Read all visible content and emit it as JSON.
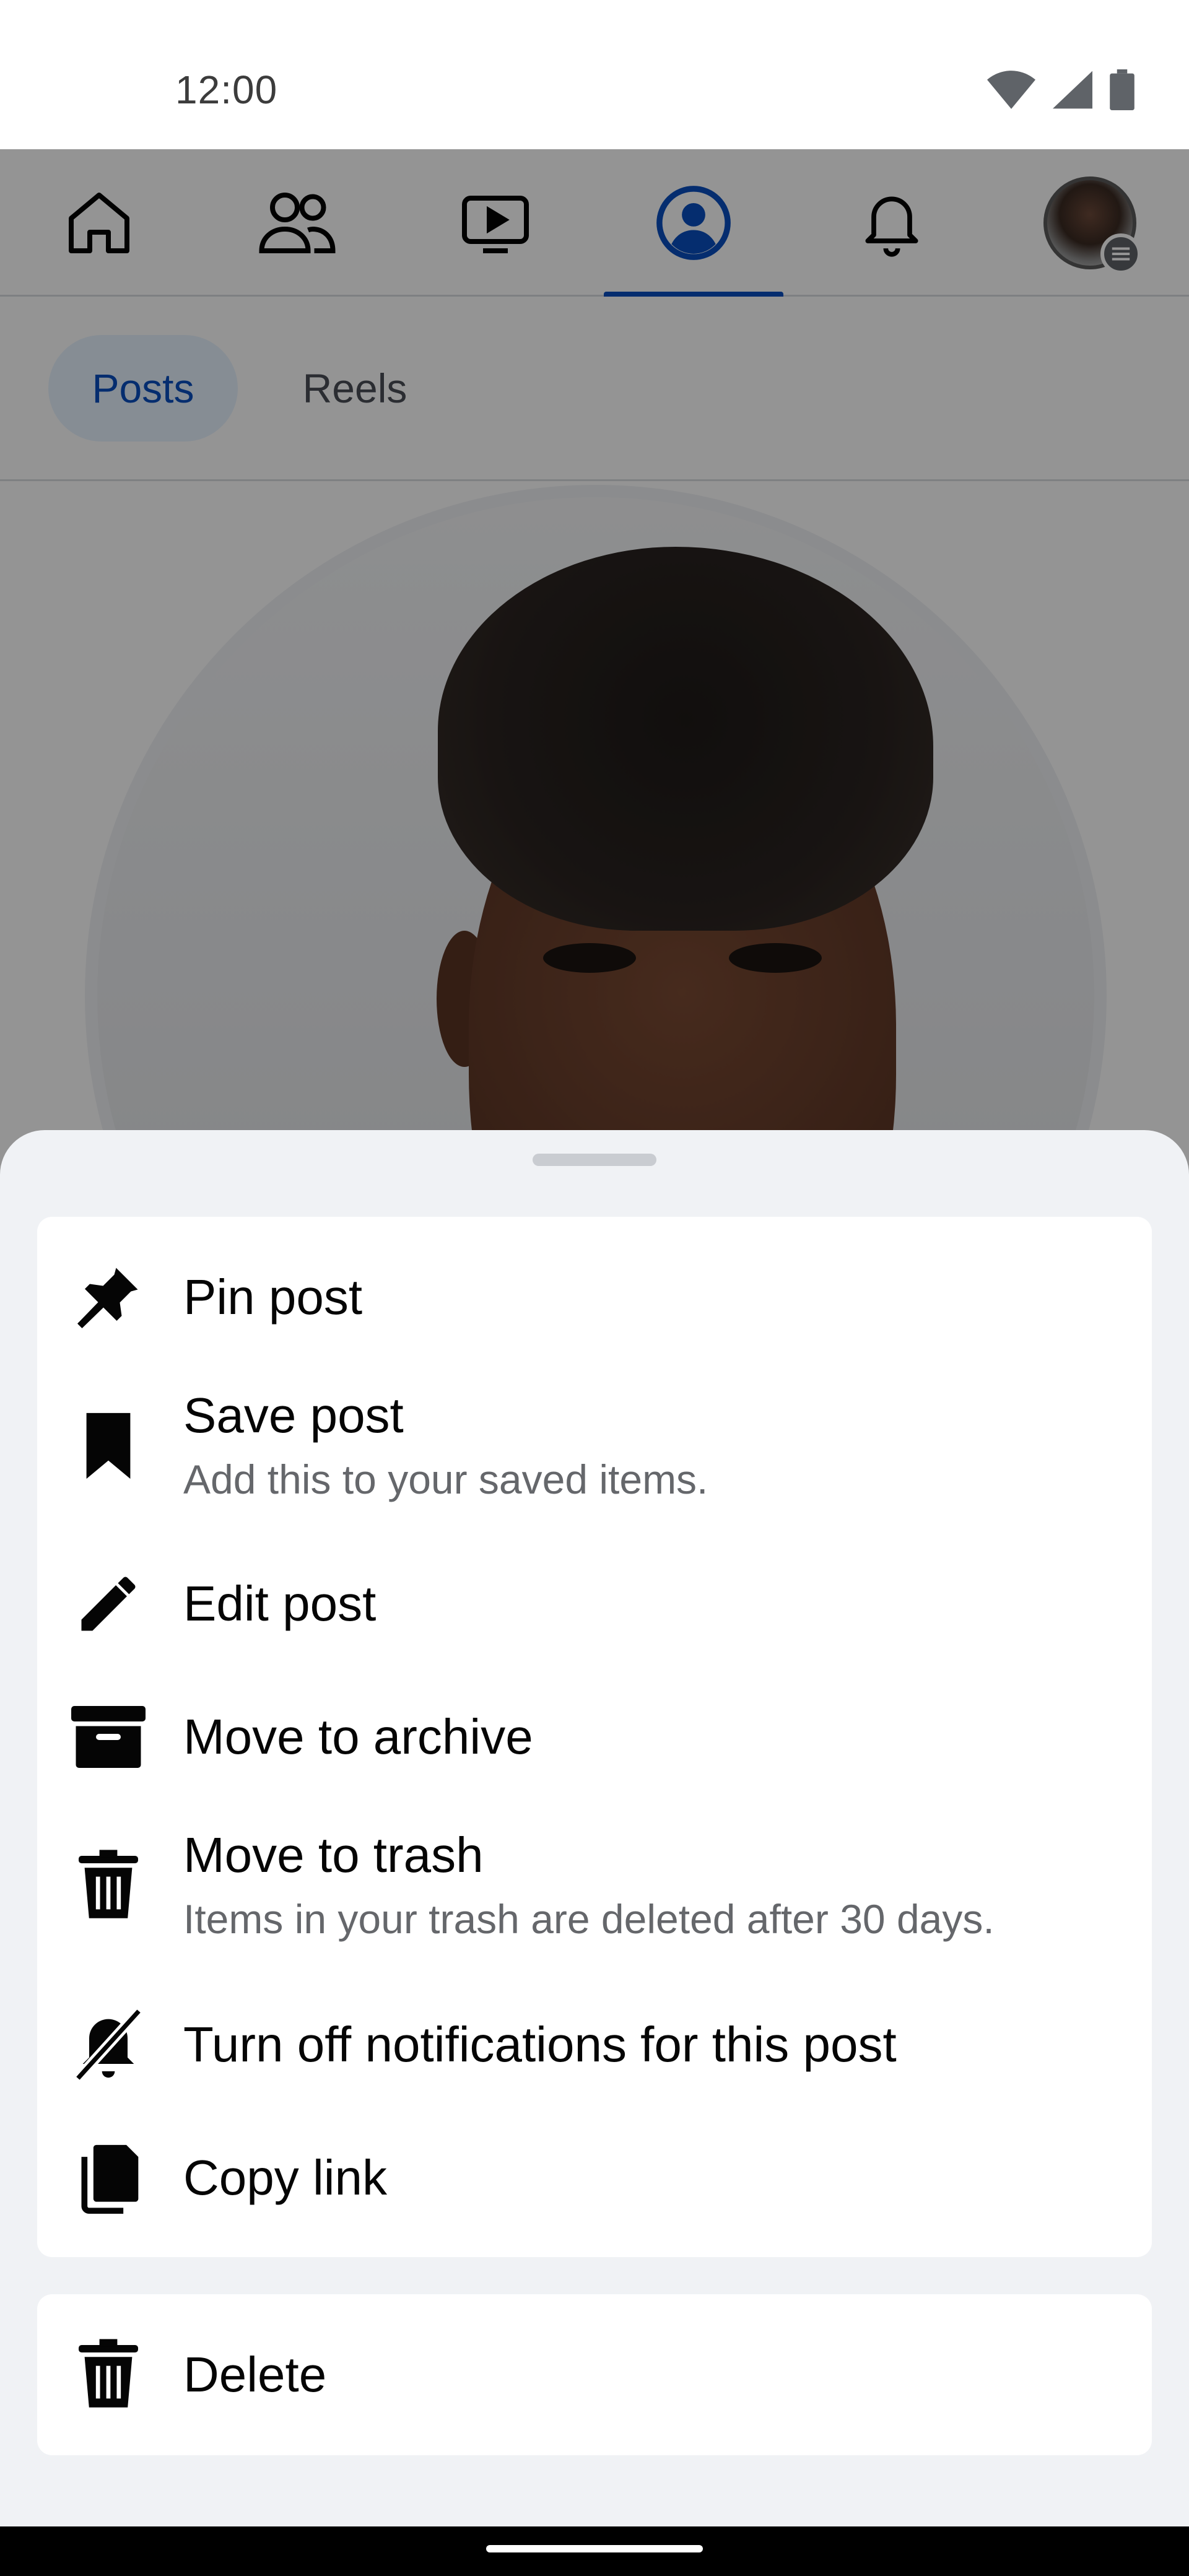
{
  "status_bar": {
    "time": "12:00",
    "icons": [
      "wifi-icon",
      "cellular-signal-icon",
      "battery-icon"
    ]
  },
  "nav": {
    "items": [
      {
        "icon": "home-icon",
        "selected": false
      },
      {
        "icon": "friends-icon",
        "selected": false
      },
      {
        "icon": "video-icon",
        "selected": false
      },
      {
        "icon": "profile-icon",
        "selected": true
      },
      {
        "icon": "bell-icon",
        "selected": false
      },
      {
        "icon": "menu-avatar-icon",
        "selected": false
      }
    ],
    "accent_color": "#0a4fbf"
  },
  "tabs": {
    "posts": "Posts",
    "reels": "Reels",
    "selected": "Posts"
  },
  "sheet": {
    "items": [
      {
        "label": "Pin post",
        "icon": "pin-icon"
      },
      {
        "label": "Save post",
        "subtitle": "Add this to your saved items.",
        "icon": "bookmark-icon"
      },
      {
        "label": "Edit post",
        "icon": "pencil-icon"
      },
      {
        "label": "Move to archive",
        "icon": "archive-icon"
      },
      {
        "label": "Move to trash",
        "subtitle": "Items in your trash are deleted after 30 days.",
        "icon": "trash-icon"
      },
      {
        "label": "Turn off notifications for this post",
        "icon": "bell-off-icon"
      },
      {
        "label": "Copy link",
        "icon": "copy-icon"
      }
    ],
    "delete": {
      "label": "Delete",
      "icon": "trash-icon"
    }
  }
}
